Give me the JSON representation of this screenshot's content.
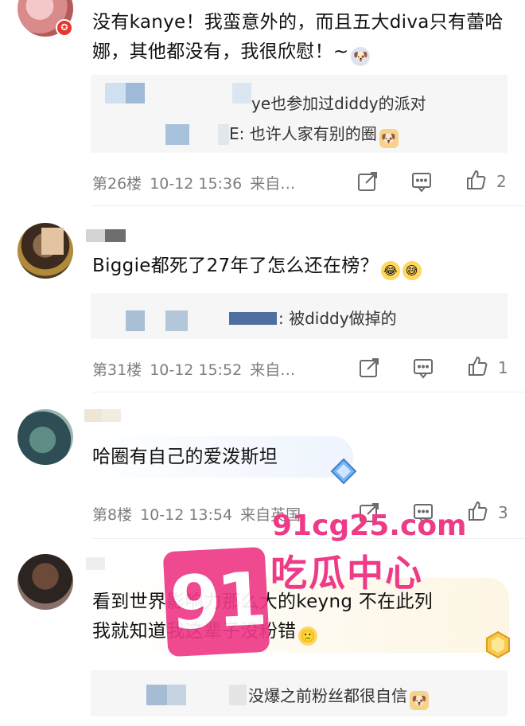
{
  "comments": [
    {
      "text": "没有kanye！我蛮意外的，而且五大diva只有蕾哈娜，其他都没有，我很欣慰！~",
      "replies": [
        {
          "text": "ye也参加过diddy的派对"
        },
        {
          "text": "E: 也许人家有别的圈"
        }
      ],
      "meta": {
        "floor": "第26楼",
        "time": "10-12 15:36",
        "source": "来自…"
      },
      "likes": "2"
    },
    {
      "text": "Biggie都死了27年了怎么还在榜？",
      "replies": [
        {
          "text": ": 被diddy做掉的"
        }
      ],
      "meta": {
        "floor": "第31楼",
        "time": "10-12 15:52",
        "source": "来自…"
      },
      "likes": "1"
    },
    {
      "text": "哈圈有自己的爱泼斯坦",
      "meta": {
        "floor": "第8楼",
        "time": "10-12 13:54",
        "source": "来自英国"
      },
      "likes": "3"
    },
    {
      "text_line1": "看到世界影响力那么大的keyng 不在此列",
      "text_line2": "我就知道我这辈子没粉错",
      "replies": [
        {
          "text": "没爆之前粉丝都很自信"
        }
      ]
    }
  ],
  "watermark": {
    "logo": "91",
    "url": "91cg25.com",
    "name": "吃瓜中心"
  },
  "colors": {
    "accent_pink": "#ee3a87",
    "meta_gray": "#7d7d7d",
    "reply_bg": "#f6f6f6"
  }
}
